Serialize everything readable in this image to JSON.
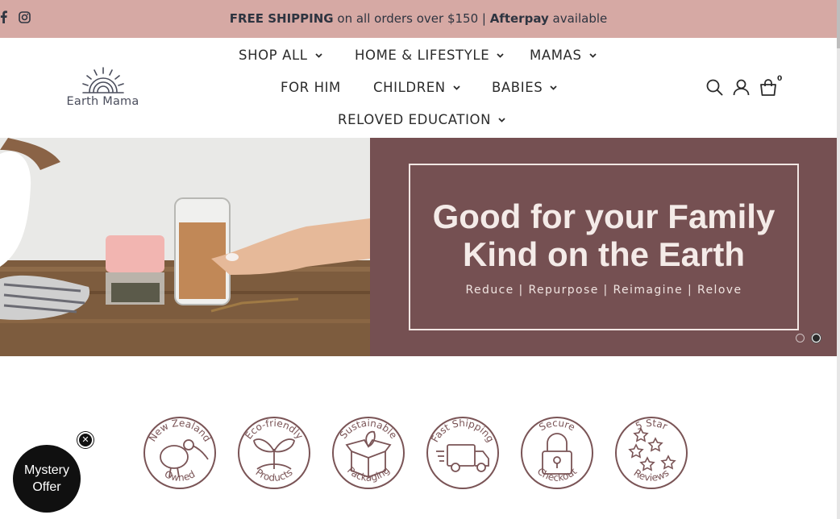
{
  "announcement": {
    "bold_1": "FREE SHIPPING",
    "text_1": " on all orders over $150 | ",
    "bold_2": "Afterpay",
    "text_2": " available"
  },
  "social": [
    "facebook-icon",
    "instagram-icon"
  ],
  "logo": {
    "wordmark": "Earth Mama"
  },
  "nav": {
    "shop_all": "SHOP ALL",
    "home_lifestyle": "HOME & LIFESTYLE",
    "mamas": "MAMAS",
    "for_him": "FOR HIM",
    "children": "CHILDREN",
    "babies": "BABIES",
    "reloved_education": "RELOVED EDUCATION"
  },
  "header_icons": {
    "search": "search-icon",
    "account": "account-icon",
    "cart": "cart-icon",
    "cart_count": "0"
  },
  "hero": {
    "headline_line1": "Good for your Family",
    "headline_line2": "Kind on the Earth",
    "tagline": "Reduce | Repurpose | Reimagine | Relove",
    "slides": 2,
    "active_slide": 2
  },
  "features": [
    {
      "top": "New Zealand",
      "bottom": "Owned",
      "icon": "kiwi-bird-icon"
    },
    {
      "top": "Eco-friendly",
      "bottom": "Products",
      "icon": "sprout-icon"
    },
    {
      "top": "Sustainable",
      "bottom": "Packaging",
      "icon": "box-icon"
    },
    {
      "top": "Fast Shipping",
      "bottom": "",
      "icon": "truck-icon"
    },
    {
      "top": "Secure",
      "bottom": "Checkout",
      "icon": "lock-icon"
    },
    {
      "top": "5 Star",
      "bottom": "Reviews",
      "icon": "stars-icon"
    }
  ],
  "mystery": {
    "line1": "Mystery",
    "line2": "Offer",
    "close": "✕"
  },
  "colors": {
    "announce_bg": "#d6a9a4",
    "hero_panel": "#755052",
    "badge_stroke": "#7a5456"
  }
}
